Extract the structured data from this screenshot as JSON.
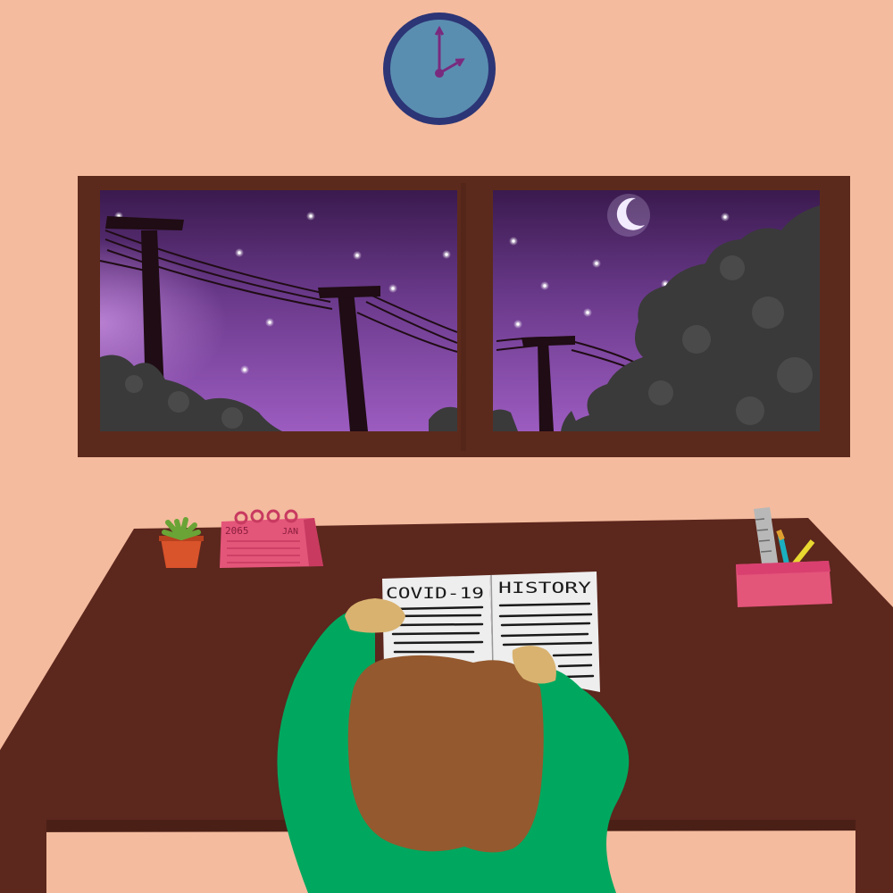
{
  "colors": {
    "wall": "#f4bb9e",
    "frame": "#5c2a1c",
    "desk": "#5c271d",
    "sky_top": "#3a1a4e",
    "sky_mid": "#6b3a8c",
    "sky_low": "#9c5cc0",
    "tree": "#3a3a3a",
    "pole": "#1f0c14",
    "clock_rim": "#2c3576",
    "clock_face": "#5a8eb0",
    "clock_hand": "#7a2a7e",
    "calendar": "#e4557a",
    "pot": "#d9532b",
    "plant": "#6aa436",
    "pencil_holder": "#e4557a",
    "shirt": "#00a85f",
    "hair": "#94592e",
    "hand": "#d9b270",
    "page": "#eeeeee",
    "ink": "#1a1a1a"
  },
  "clock": {
    "hour": 2,
    "minute": 0
  },
  "calendar": {
    "year": "2065",
    "month": "JAN"
  },
  "book": {
    "left_title": "COVID-19",
    "right_title": "HISTORY"
  }
}
